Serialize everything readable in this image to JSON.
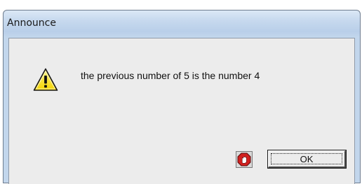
{
  "window": {
    "title": "Announce"
  },
  "dialog": {
    "message": "the previous number of 5 is the number 4",
    "icon": "warning-icon"
  },
  "buttons": {
    "stop_icon": "stop-hand-icon",
    "ok_label": "OK"
  }
}
